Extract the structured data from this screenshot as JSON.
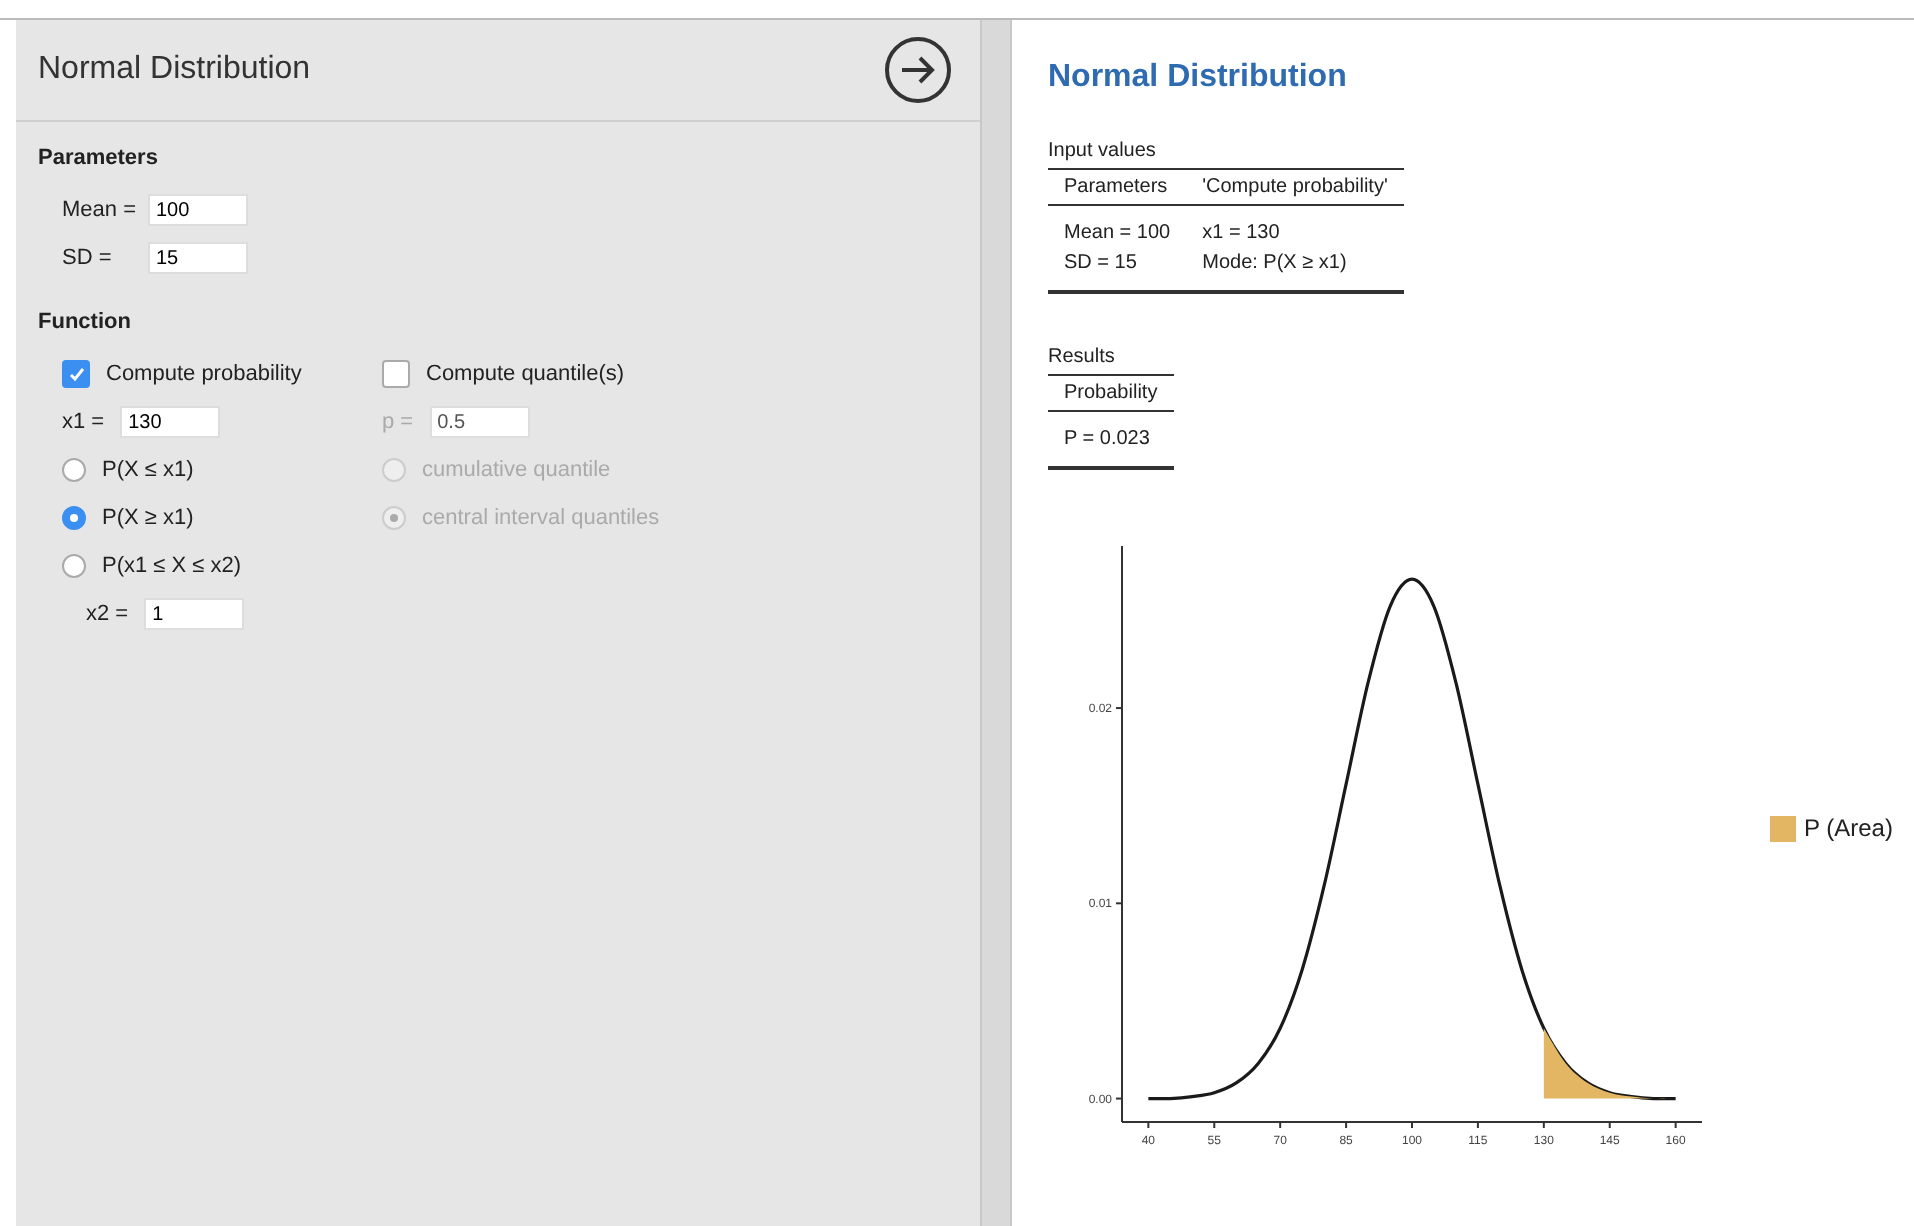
{
  "panel": {
    "title": "Normal Distribution"
  },
  "parameters": {
    "heading": "Parameters",
    "fields": [
      {
        "label": "Mean =",
        "value": "100"
      },
      {
        "label": "SD =",
        "value": "15"
      }
    ]
  },
  "function": {
    "heading": "Function",
    "probability": {
      "label": "Compute probability",
      "checked": true,
      "field": {
        "label": "x1 =",
        "value": "130"
      },
      "options": [
        {
          "label": "P(X ≤ x1)",
          "selected": false
        },
        {
          "label": "P(X ≥ x1)",
          "selected": true
        },
        {
          "label": "P(x1 ≤ X ≤ x2)",
          "selected": false
        }
      ],
      "x2": {
        "label": "x2 =",
        "value": "1"
      }
    },
    "quantile": {
      "label": "Compute quantile(s)",
      "checked": false,
      "disabled": true,
      "field": {
        "label": "p =",
        "value": "0.5"
      },
      "options": [
        {
          "label": "cumulative quantile",
          "selected": false
        },
        {
          "label": "central interval quantiles",
          "selected": true
        }
      ]
    }
  },
  "output": {
    "title": "Normal Distribution",
    "input_table": {
      "caption": "Input values",
      "columns": [
        "Parameters",
        "'Compute probability'"
      ],
      "rows": [
        [
          "Mean = 100",
          "x1 = 130"
        ],
        [
          "SD = 15",
          "Mode: P(X ≥ x1)"
        ]
      ]
    },
    "results_table": {
      "caption": "Results",
      "columns": [
        "Probability"
      ],
      "rows": [
        [
          "P = 0.023"
        ]
      ]
    },
    "chart_data": {
      "type": "line",
      "x": [
        40,
        45,
        50,
        55,
        60,
        65,
        70,
        75,
        80,
        85,
        90,
        95,
        100,
        105,
        110,
        115,
        120,
        125,
        130,
        135,
        140,
        145,
        150,
        155,
        160
      ],
      "series": [
        {
          "type": "line",
          "color": "#1a1a1a",
          "values": [
            0.0,
            0.0,
            0.0001,
            0.0003,
            0.0008,
            0.0018,
            0.0036,
            0.0066,
            0.0109,
            0.0161,
            0.0213,
            0.0252,
            0.0266,
            0.0252,
            0.0213,
            0.0161,
            0.0109,
            0.0066,
            0.0036,
            0.0018,
            0.0008,
            0.0003,
            0.0001,
            0.0,
            0.0
          ]
        },
        {
          "type": "area",
          "name": "P (Area)",
          "color": "#e2b663",
          "values": [
            null,
            null,
            null,
            null,
            null,
            null,
            null,
            null,
            null,
            null,
            null,
            null,
            null,
            null,
            null,
            null,
            null,
            null,
            0.0036,
            0.0018,
            0.0008,
            0.0003,
            0.0001,
            0.0,
            0.0
          ]
        }
      ],
      "xlim": [
        34,
        166
      ],
      "ylim": [
        -0.0012,
        0.0283
      ],
      "xticks": [
        40,
        55,
        70,
        85,
        100,
        115,
        130,
        145,
        160
      ],
      "yticks": [
        {
          "value": 0,
          "label": "0.00"
        },
        {
          "value": 0.01,
          "label": "0.01"
        },
        {
          "value": 0.02,
          "label": "0.02"
        }
      ]
    }
  }
}
